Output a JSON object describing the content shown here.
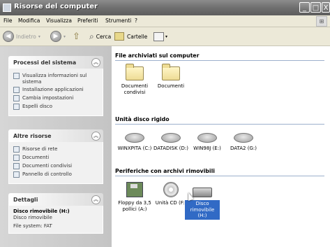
{
  "window": {
    "title": "Risorse del computer",
    "controls": [
      "_",
      "□",
      "X"
    ]
  },
  "menu": [
    "File",
    "Modifica",
    "Visualizza",
    "Preferiti",
    "Strumenti",
    "?"
  ],
  "toolbar": {
    "back": "Indietro",
    "search": "Cerca",
    "folders": "Cartelle"
  },
  "sidebar": {
    "processi": {
      "title": "Processi del sistema",
      "items": [
        "Visualizza informazioni sul sistema",
        "Installazione applicazioni",
        "Cambia impostazioni",
        "Espelli disco"
      ]
    },
    "altre": {
      "title": "Altre risorse",
      "items": [
        "Risorse di rete",
        "Documenti",
        "Documenti condivisi",
        "Pannello di controllo"
      ]
    },
    "dettagli": {
      "title": "Dettagli",
      "name": "Disco rimovibile (H:)",
      "type": "Disco rimovibile",
      "fs": "File system: FAT"
    }
  },
  "groups": {
    "shared": {
      "title": "File archiviati sul computer",
      "items": [
        {
          "label": "Documenti condivisi",
          "icon": "shared-folder-icon"
        },
        {
          "label": "Documenti",
          "icon": "folder-icon"
        }
      ]
    },
    "hdd": {
      "title": "Unità disco rigido",
      "items": [
        {
          "label": "WINXPITA (C:)",
          "icon": "hard-disk-icon"
        },
        {
          "label": "DATADISK (D:)",
          "icon": "hard-disk-icon"
        },
        {
          "label": "WIN98J (E:)",
          "icon": "hard-disk-icon"
        },
        {
          "label": "DATA2 (G:)",
          "icon": "hard-disk-icon"
        }
      ]
    },
    "removable": {
      "title": "Periferiche con archivi rimovibili",
      "items": [
        {
          "label": "Floppy da 3,5 pollici (A:)",
          "icon": "floppy-icon"
        },
        {
          "label": "Unità CD (F:)",
          "icon": "cd-drive-icon"
        },
        {
          "label": "Disco rimovibile (H:)",
          "icon": "removable-disk-icon",
          "selected": true
        }
      ]
    }
  }
}
